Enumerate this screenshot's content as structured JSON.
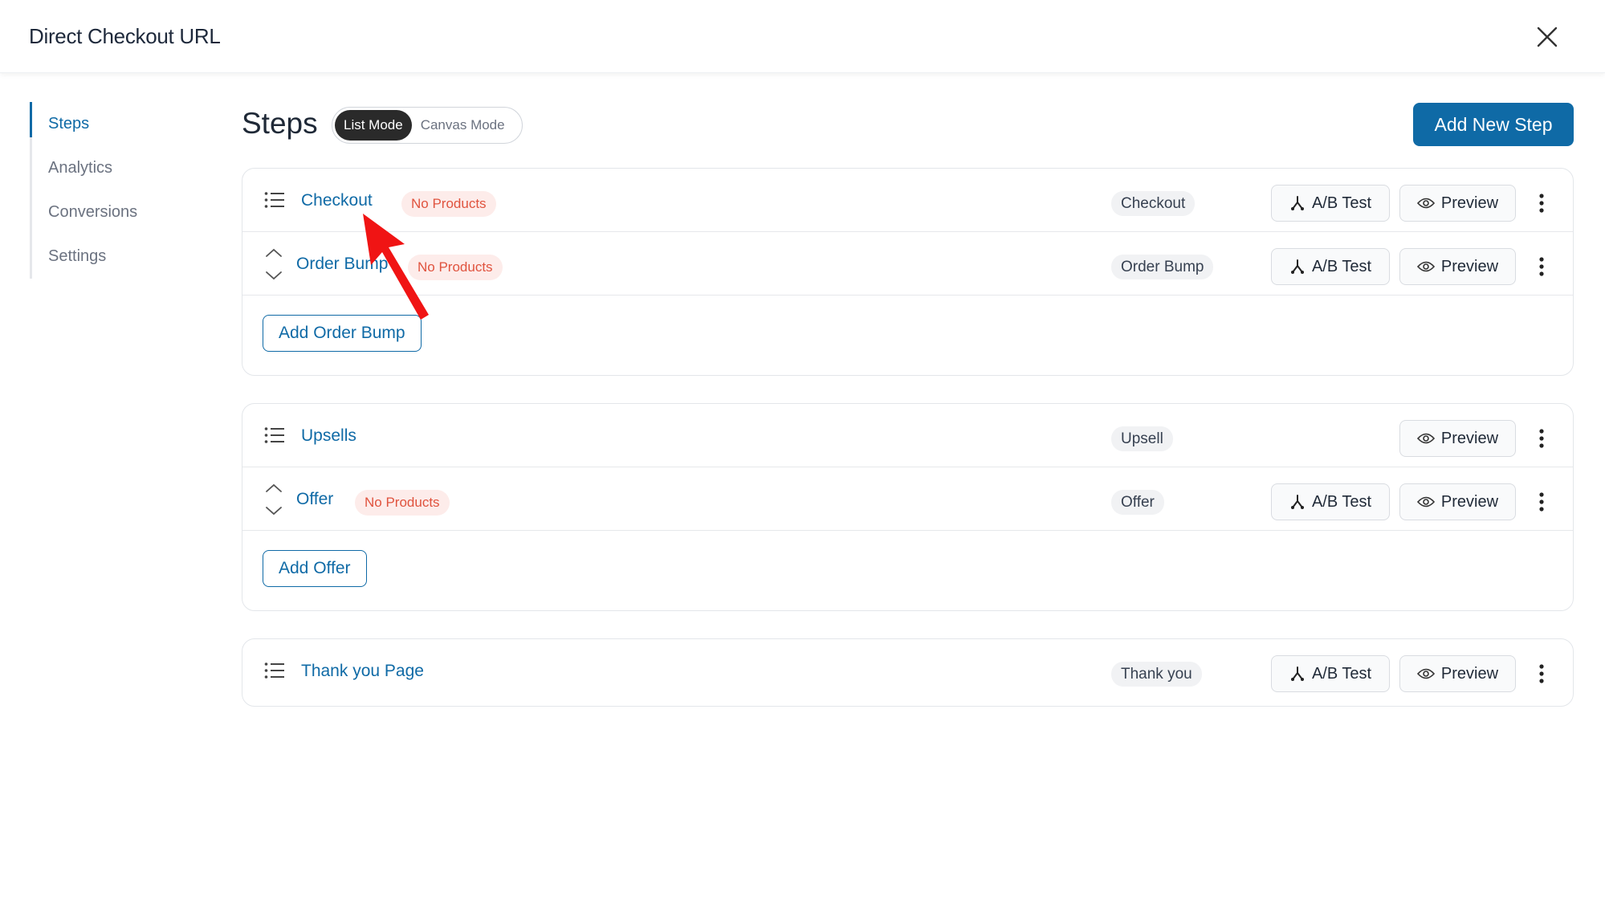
{
  "window": {
    "title": "Direct Checkout URL"
  },
  "sidebar": {
    "items": [
      {
        "label": "Steps",
        "active": true
      },
      {
        "label": "Analytics",
        "active": false
      },
      {
        "label": "Conversions",
        "active": false
      },
      {
        "label": "Settings",
        "active": false
      }
    ]
  },
  "header": {
    "title": "Steps",
    "modes": [
      "List Mode",
      "Canvas Mode"
    ],
    "active_mode": "List Mode",
    "add_button": "Add New Step"
  },
  "labels": {
    "no_products": "No Products",
    "ab_test": "A/B Test",
    "preview": "Preview"
  },
  "groups": [
    {
      "rows": [
        {
          "name": "Checkout",
          "type": "Checkout",
          "no_products": true,
          "ab_test": true
        },
        {
          "name": "Order Bump",
          "type": "Order Bump",
          "no_products": true,
          "ab_test": true
        }
      ],
      "add_button": "Add Order Bump"
    },
    {
      "rows": [
        {
          "name": "Upsells",
          "type": "Upsell",
          "no_products": false,
          "ab_test": false
        },
        {
          "name": "Offer",
          "type": "Offer",
          "no_products": true,
          "ab_test": true
        }
      ],
      "add_button": "Add Offer"
    },
    {
      "rows": [
        {
          "name": "Thank you Page",
          "type": "Thank you",
          "no_products": false,
          "ab_test": true
        }
      ]
    }
  ],
  "colors": {
    "accent": "#0f6aa6",
    "badge_red_bg": "#fdecea",
    "badge_red_text": "#e0533e",
    "annotation_arrow": "#f01414"
  }
}
